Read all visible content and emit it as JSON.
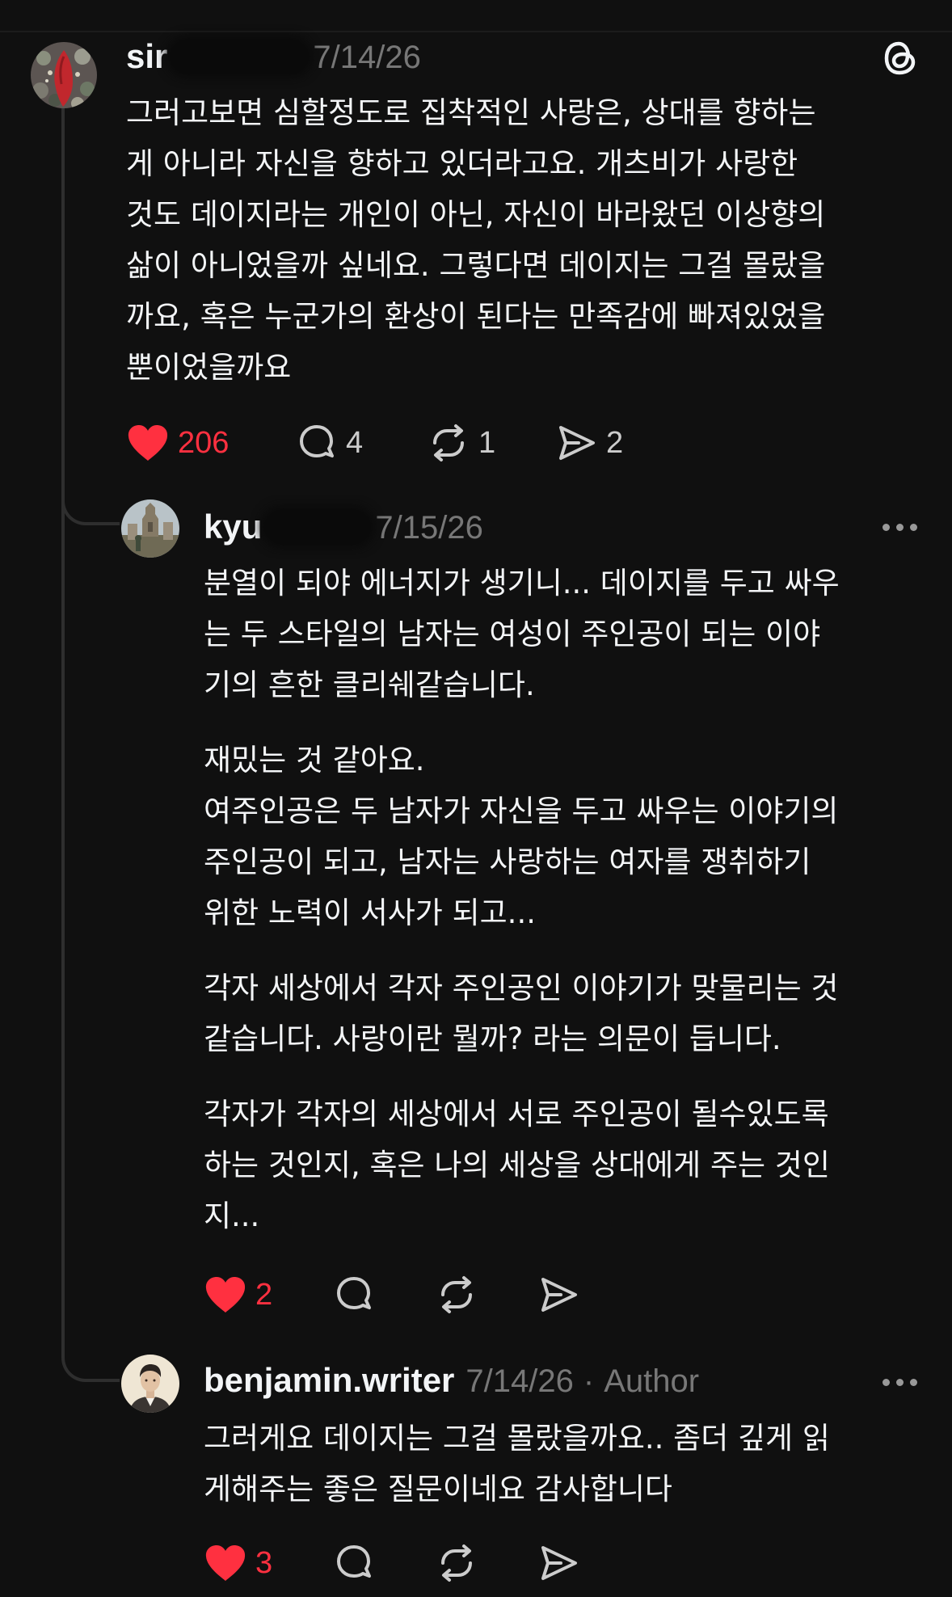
{
  "colors": {
    "background": "#101010",
    "text": "#f3f5f7",
    "secondary": "#777777",
    "like": "#ff3040",
    "thread_line": "#2e2e2e"
  },
  "posts": [
    {
      "username": "sir",
      "timestamp": "7/14/26",
      "lines": [
        "그러고보면 심할정도로 집착적인 사랑은, 상대를 향하는",
        "게 아니라 자신을 향하고 있더라고요. 개츠비가 사랑한",
        "것도 데이지라는 개인이 아닌, 자신이 바라왔던 이상향의",
        "삶이 아니었을까 싶네요. 그렇다면 데이지는 그걸 몰랐을",
        "까요, 혹은 누군가의 환상이 된다는 만족감에 빠져있었을",
        "뿐이었을까요"
      ],
      "likes": "206",
      "replies": "4",
      "reposts": "1",
      "shares": "2",
      "liked": true
    },
    {
      "username": "kyu",
      "timestamp": "7/15/26",
      "paragraphs": [
        [
          "분열이 되야 에너지가 생기니... 데이지를 두고 싸우",
          "는  두 스타일의 남자는 여성이 주인공이 되는 이야",
          "기의 흔한 클리쉐같습니다."
        ],
        [
          "재밌는 것 같아요.",
          "여주인공은 두 남자가 자신을 두고 싸우는 이야기의",
          "주인공이 되고, 남자는 사랑하는 여자를 쟁취하기",
          "위한 노력이 서사가 되고..."
        ],
        [
          "각자 세상에서 각자 주인공인 이야기가 맞물리는 것",
          "같습니다. 사랑이란 뭘까? 라는 의문이 듭니다."
        ],
        [
          "각자가 각자의 세상에서 서로 주인공이 될수있도록",
          "하는 것인지, 혹은 나의 세상을 상대에게 주는 것인",
          "지..."
        ]
      ],
      "likes": "2",
      "liked": true
    },
    {
      "username": "benjamin.writer",
      "timestamp": "7/14/26",
      "separator": "·",
      "author_tag": "Author",
      "lines": [
        "그러게요 데이지는 그걸 몰랐을까요.. 좀더 깊게 읽",
        "게해주는 좋은 질문이네요 감사합니다"
      ],
      "likes": "3",
      "liked": true
    }
  ]
}
